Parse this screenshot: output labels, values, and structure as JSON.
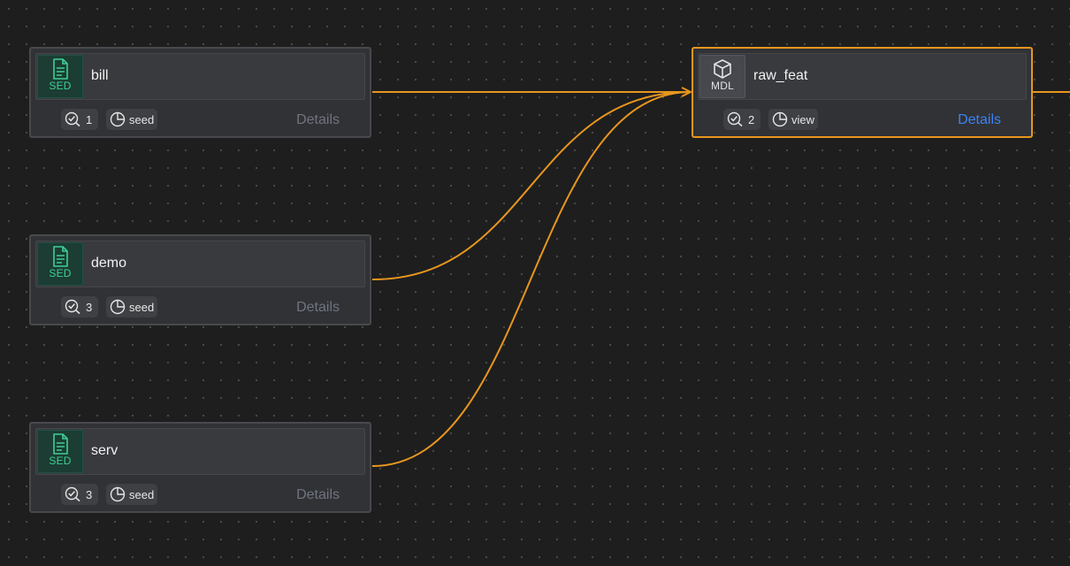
{
  "colors": {
    "edge": "#e8961e",
    "selected_border": "#e8961e",
    "seed_accent": "#3ecf95",
    "details_active": "#3b82f6",
    "details_inactive": "#6f7480"
  },
  "nodes": {
    "bill": {
      "badge": "SED",
      "badge_icon": "file-text-icon",
      "name": "bill",
      "tests": "1",
      "materialization": "seed",
      "details": "Details"
    },
    "demo": {
      "badge": "SED",
      "badge_icon": "file-text-icon",
      "name": "demo",
      "tests": "3",
      "materialization": "seed",
      "details": "Details"
    },
    "serv": {
      "badge": "SED",
      "badge_icon": "file-text-icon",
      "name": "serv",
      "tests": "3",
      "materialization": "seed",
      "details": "Details"
    },
    "raw_feat": {
      "badge": "MDL",
      "badge_icon": "cube-icon",
      "name": "raw_feat",
      "tests": "2",
      "materialization": "view",
      "details": "Details",
      "selected": true
    }
  }
}
